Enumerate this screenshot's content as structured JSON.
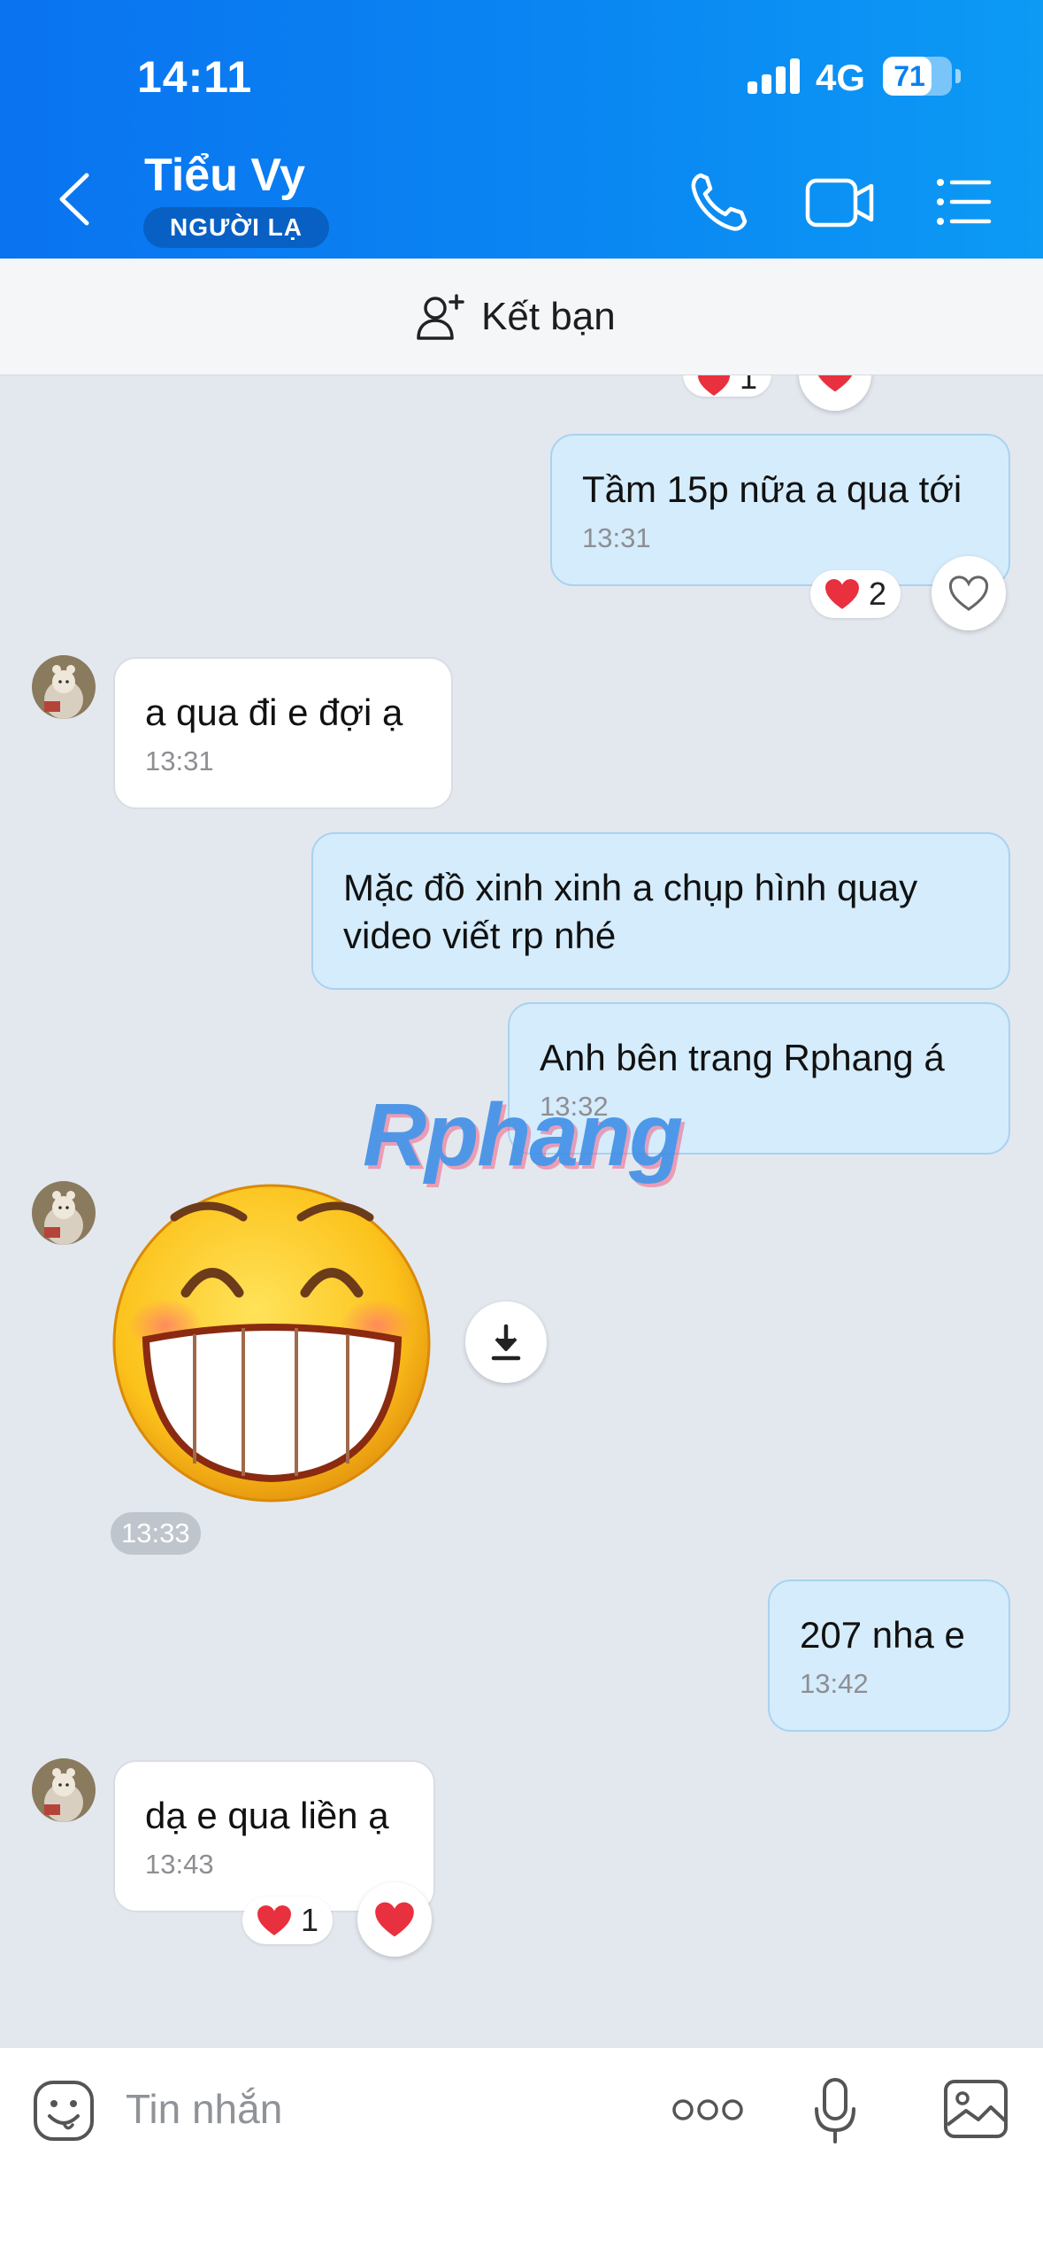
{
  "status_bar": {
    "time": "14:11",
    "network": "4G",
    "battery": "71",
    "battery_level": 0.71
  },
  "header": {
    "contact_name": "Tiểu Vy",
    "badge": "NGƯỜI LẠ",
    "icons": [
      "back-icon",
      "phone-icon",
      "video-call-icon",
      "menu-list-icon"
    ]
  },
  "friend_bar": {
    "label": "Kết bạn",
    "icon": "add-friend-icon"
  },
  "messages": [
    {
      "dir": "out",
      "text": "Tầm 15p nữa a qua tới",
      "time": "13:31",
      "reaction_count": "2"
    },
    {
      "dir": "in",
      "text": "a qua đi e đợi ạ",
      "time": "13:31"
    },
    {
      "dir": "out",
      "text": "Mặc đồ xinh xinh a chụp hình quay video viết rp nhé",
      "time": ""
    },
    {
      "dir": "out",
      "text": "Anh bên trang Rphang á",
      "time": "13:32"
    },
    {
      "dir": "in",
      "type": "sticker",
      "sticker": "grinning-face-sticker",
      "time": "13:33"
    },
    {
      "dir": "out",
      "text": "207 nha e",
      "time": "13:42"
    },
    {
      "dir": "in",
      "text": "dạ e qua liền ạ",
      "time": "13:43",
      "reaction_count": "1"
    }
  ],
  "top_partial_reaction": {
    "count": "1"
  },
  "watermark": "Rphang",
  "input": {
    "placeholder": "Tin nhắn",
    "icons": [
      "emoji-icon",
      "more-options-icon",
      "microphone-icon",
      "image-icon"
    ]
  },
  "colors": {
    "header": "#0a86f2",
    "outgoing_bubble": "#d4ecfb",
    "incoming_bubble": "#ffffff",
    "background": "#e3e8ef"
  }
}
